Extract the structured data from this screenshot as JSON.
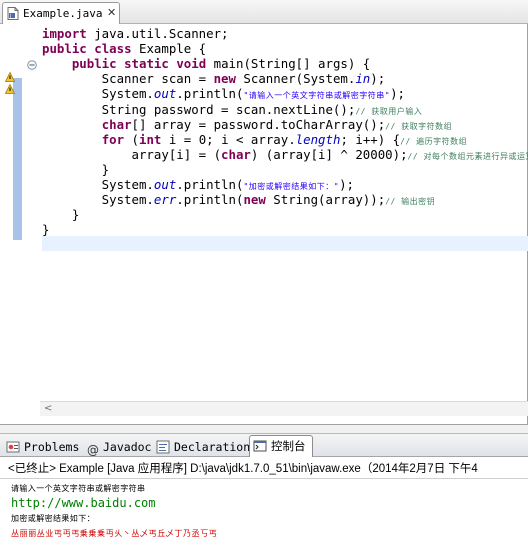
{
  "editor": {
    "tab_label": "Example.java",
    "tab_close": "✕",
    "code": [
      [
        {
          "t": "import",
          "c": "kw"
        },
        {
          "t": " java.util.Scanner;"
        }
      ],
      [
        {
          "t": "public",
          "c": "kw"
        },
        {
          "t": " "
        },
        {
          "t": "class",
          "c": "kw"
        },
        {
          "t": " Example {"
        }
      ],
      [
        {
          "t": "    "
        },
        {
          "t": "public",
          "c": "kw"
        },
        {
          "t": " "
        },
        {
          "t": "static",
          "c": "kw"
        },
        {
          "t": " "
        },
        {
          "t": "void",
          "c": "kw"
        },
        {
          "t": " main(String[] args) {"
        }
      ],
      [
        {
          "t": "        Scanner scan = "
        },
        {
          "t": "new",
          "c": "kw"
        },
        {
          "t": " Scanner(System."
        },
        {
          "t": "in",
          "c": "fld"
        },
        {
          "t": ");"
        }
      ],
      [
        {
          "t": "        System."
        },
        {
          "t": "out",
          "c": "fld"
        },
        {
          "t": ".println("
        },
        {
          "t": "\"请输入一个英文字符串或解密字符串\"",
          "c": "str"
        },
        {
          "t": ");"
        }
      ],
      [
        {
          "t": "        String password = scan.nextLine();"
        },
        {
          "t": "// 获取用户输入",
          "c": "cmt"
        }
      ],
      [
        {
          "t": "        "
        },
        {
          "t": "char",
          "c": "kw"
        },
        {
          "t": "[] array = password.toCharArray();"
        },
        {
          "t": "// 获取字符数组",
          "c": "cmt"
        }
      ],
      [
        {
          "t": "        "
        },
        {
          "t": "for",
          "c": "kw"
        },
        {
          "t": " ("
        },
        {
          "t": "int",
          "c": "kw"
        },
        {
          "t": " i = 0; i < array."
        },
        {
          "t": "length",
          "c": "fld"
        },
        {
          "t": "; i++) {"
        },
        {
          "t": "// 遍历字符数组",
          "c": "cmt"
        }
      ],
      [
        {
          "t": "            array[i] = ("
        },
        {
          "t": "char",
          "c": "kw"
        },
        {
          "t": ") (array[i] ^ 20000);"
        },
        {
          "t": "// 对每个数组元素进行异或运算",
          "c": "cmt"
        }
      ],
      [
        {
          "t": "        }"
        }
      ],
      [
        {
          "t": "        System."
        },
        {
          "t": "out",
          "c": "fld"
        },
        {
          "t": ".println("
        },
        {
          "t": "\"加密或解密结果如下：\"",
          "c": "str"
        },
        {
          "t": ");"
        }
      ],
      [
        {
          "t": "        System."
        },
        {
          "t": "err",
          "c": "fld"
        },
        {
          "t": ".println("
        },
        {
          "t": "new",
          "c": "kw"
        },
        {
          "t": " String(array));"
        },
        {
          "t": "// 输出密钥",
          "c": "cmt"
        }
      ],
      [
        {
          "t": "    }"
        }
      ],
      [
        {
          "t": "}"
        }
      ]
    ],
    "scroll_left_arrow": "<"
  },
  "panel": {
    "tabs": [
      {
        "label": "Problems",
        "icon": "problems-icon"
      },
      {
        "label": "Javadoc",
        "icon": "at-sign-icon",
        "glyph": "@"
      },
      {
        "label": "Declaration",
        "icon": "declaration-icon"
      },
      {
        "label": "控制台",
        "icon": "console-icon"
      }
    ],
    "console_header": "<已终止> Example [Java 应用程序] D:\\java\\jdk1.7.0_51\\bin\\javaw.exe（2014年2月7日 下午4",
    "console_lines": [
      {
        "text": "请输入一个英文字符串或解密字符串",
        "kind": "c-small"
      },
      {
        "text": "http://www.baidu.com",
        "kind": "c-link"
      },
      {
        "text": "加密或解密结果如下：",
        "kind": "c-small"
      },
      {
        "text": "丛丽丽丛业丐丏丐乗乗乗丏乆丶丛乄丐丘乄丁乃丞丂丐",
        "kind": "c-err"
      }
    ]
  },
  "colors": {
    "keyword": "#7f0055",
    "field": "#0000c0",
    "string": "#2a00ff",
    "comment": "#3f7f5f",
    "console_link": "#008000",
    "console_err": "#d00000"
  }
}
